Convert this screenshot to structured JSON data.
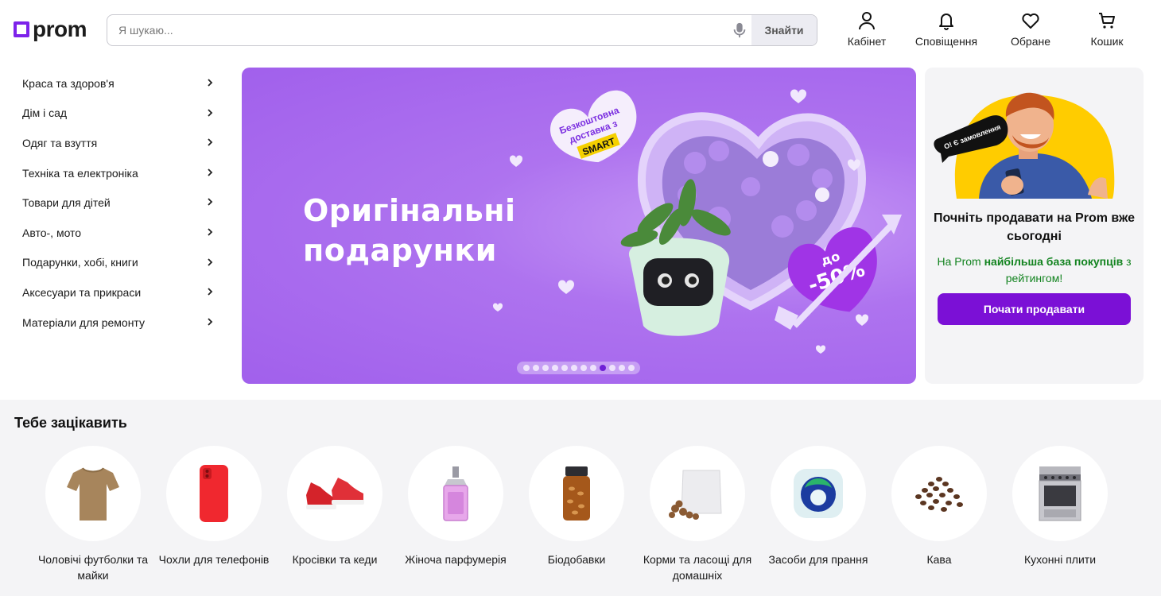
{
  "header": {
    "logo_text": "prom",
    "search_placeholder": "Я шукаю...",
    "search_button": "Знайти",
    "nav": [
      {
        "label": "Кабінет",
        "icon": "user-icon"
      },
      {
        "label": "Сповіщення",
        "icon": "bell-icon"
      },
      {
        "label": "Обране",
        "icon": "heart-icon"
      },
      {
        "label": "Кошик",
        "icon": "cart-icon"
      }
    ]
  },
  "sidebar": {
    "items": [
      {
        "label": "Краса та здоров'я"
      },
      {
        "label": "Дім і сад"
      },
      {
        "label": "Одяг та взуття"
      },
      {
        "label": "Техніка та електроніка"
      },
      {
        "label": "Товари для дітей"
      },
      {
        "label": "Авто-, мото"
      },
      {
        "label": "Подарунки, хобі, книги"
      },
      {
        "label": "Аксесуари та прикраси"
      },
      {
        "label": "Матеріали для ремонту"
      }
    ]
  },
  "banner": {
    "title_line1": "Оригінальні",
    "title_line2": "подарунки",
    "badge_line1": "Безкоштовна",
    "badge_line2": "доставка з",
    "badge_brand": "SMART",
    "discount_line1": "до",
    "discount_line2": "-50%",
    "bubble_text": "О! Є замовлення",
    "slide_count": 12,
    "active_slide": 9,
    "colors": {
      "accent": "#7b10d6",
      "banner_bg": "#a160ec"
    }
  },
  "sell_card": {
    "title": "Почніть продавати на Prom вже сьогодні",
    "sub_prefix": "На Prom ",
    "sub_bold": "найбільша база покупців",
    "sub_suffix": " з рейтингом!",
    "button": "Почати продавати",
    "bubble": "О! Є замовлення"
  },
  "interest": {
    "title": "Тебе зацікавить",
    "categories": [
      {
        "label": "Чоловічі футболки та майки",
        "icon": "tshirt-icon"
      },
      {
        "label": "Чохли для телефонів",
        "icon": "phone-case-icon"
      },
      {
        "label": "Кросівки та кеди",
        "icon": "sneakers-icon"
      },
      {
        "label": "Жіноча парфумерія",
        "icon": "perfume-icon"
      },
      {
        "label": "Біодобавки",
        "icon": "supplement-jar-icon"
      },
      {
        "label": "Корми та ласощі для домашніх",
        "icon": "pet-food-icon"
      },
      {
        "label": "Засоби для прання",
        "icon": "laundry-capsule-icon"
      },
      {
        "label": "Кава",
        "icon": "coffee-beans-icon"
      },
      {
        "label": "Кухонні плити",
        "icon": "stove-icon"
      }
    ]
  }
}
